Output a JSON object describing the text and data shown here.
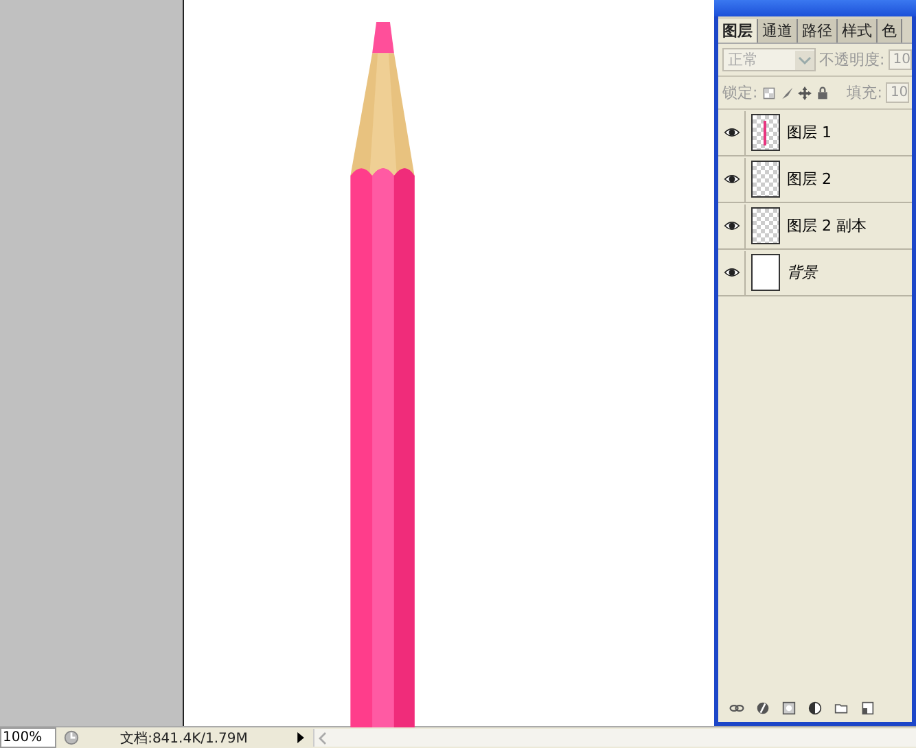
{
  "layers_panel": {
    "tabs": [
      {
        "label": "图层",
        "selected": true
      },
      {
        "label": "通道",
        "selected": false
      },
      {
        "label": "路径",
        "selected": false
      },
      {
        "label": "样式",
        "selected": false
      },
      {
        "label": "色",
        "selected": false
      }
    ],
    "blend_mode": {
      "value": "正常",
      "disabled": true
    },
    "opacity": {
      "label": "不透明度:",
      "value": "10",
      "disabled": true
    },
    "lock": {
      "label": "锁定:"
    },
    "fill": {
      "label": "填充:",
      "value": "10",
      "disabled": true
    },
    "layers": [
      {
        "name": "图层 1",
        "kind": "stroke",
        "visible": true,
        "selected": false
      },
      {
        "name": "图层 2",
        "kind": "transparent",
        "visible": true,
        "selected": false
      },
      {
        "name": "图层 2 副本",
        "kind": "transparent",
        "visible": true,
        "selected": false
      },
      {
        "name": "背景",
        "kind": "background",
        "visible": true,
        "selected": false
      }
    ]
  },
  "status_bar": {
    "zoom": "100%",
    "document_info": "文档:841.4K/1.79M"
  }
}
